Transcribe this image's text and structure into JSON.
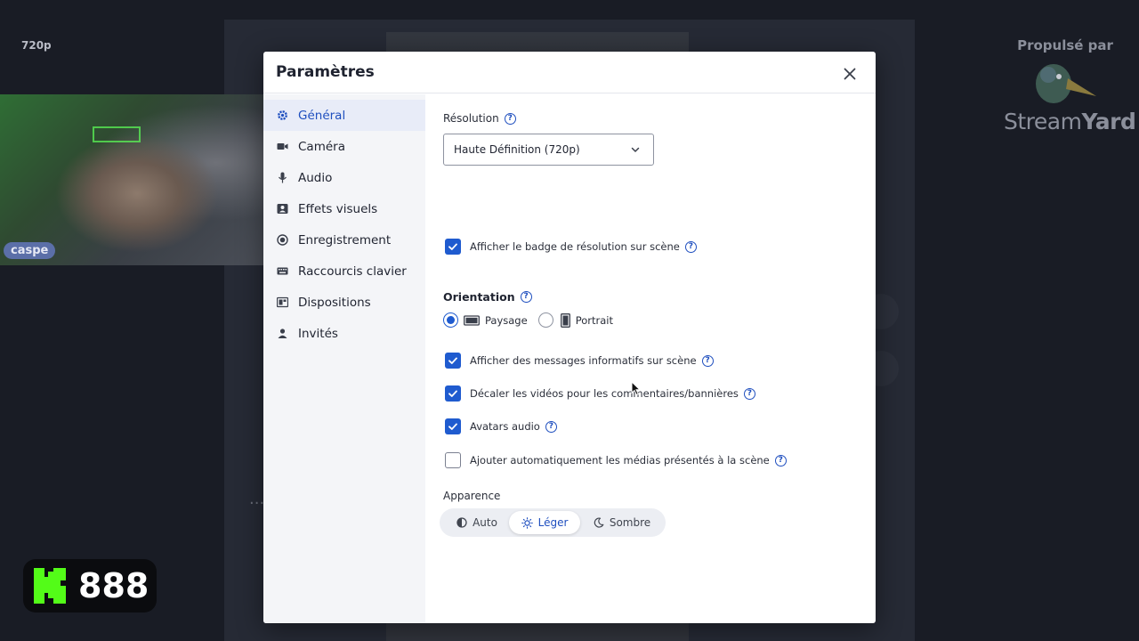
{
  "background": {
    "resolution_badge": "720p",
    "camera_name": "caspe",
    "powered_by": "Propulsé par",
    "brand_name_regular": "Stream",
    "brand_name_bold": "Yard",
    "kick_count": "888"
  },
  "modal": {
    "title": "Paramètres",
    "nav": [
      {
        "label": "Général",
        "icon": "gear-icon",
        "active": true
      },
      {
        "label": "Caméra",
        "icon": "camera-icon"
      },
      {
        "label": "Audio",
        "icon": "microphone-icon"
      },
      {
        "label": "Effets visuels",
        "icon": "portrait-icon"
      },
      {
        "label": "Enregistrement",
        "icon": "record-icon"
      },
      {
        "label": "Raccourcis clavier",
        "icon": "keyboard-icon"
      },
      {
        "label": "Dispositions",
        "icon": "layout-icon"
      },
      {
        "label": "Invités",
        "icon": "person-icon"
      }
    ],
    "general": {
      "resolution_label": "Résolution",
      "resolution_value": "Haute Définition (720p)",
      "show_resolution_badge": {
        "label": "Afficher le badge de résolution sur scène",
        "checked": true
      },
      "orientation_label": "Orientation",
      "orientation_options": [
        {
          "label": "Paysage",
          "selected": true
        },
        {
          "label": "Portrait",
          "selected": false
        }
      ],
      "options": [
        {
          "label": "Afficher des messages informatifs sur scène",
          "checked": true
        },
        {
          "label": "Décaler les vidéos pour les commentaires/bannières",
          "checked": true
        },
        {
          "label": "Avatars audio",
          "checked": true
        },
        {
          "label": "Ajouter automatiquement les médias présentés à la scène",
          "checked": false
        }
      ],
      "appearance_label": "Apparence",
      "appearance_options": [
        {
          "label": "Auto",
          "selected": false
        },
        {
          "label": "Léger",
          "selected": true
        },
        {
          "label": "Sombre",
          "selected": false
        }
      ]
    }
  },
  "colors": {
    "accent": "#1f5bcf",
    "active_text": "#1f4fbf",
    "sidebar_bg": "#f4f5f8",
    "overlay_bg": "#191c25",
    "kick_green": "#53fc18"
  }
}
